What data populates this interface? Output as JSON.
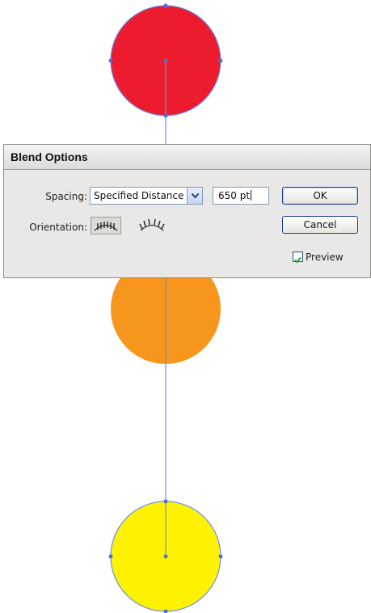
{
  "artwork": {
    "colors": {
      "path": "#6b8ff0",
      "anchor": "#4c6fe0",
      "top_circle": "#ec1c2e",
      "middle_circle": "#f7961c",
      "bottom_circle": "#fff200"
    }
  },
  "dialog": {
    "title": "Blend Options",
    "spacing": {
      "label": "Spacing:",
      "selected": "Specified Distance",
      "value": "650 pt"
    },
    "orientation": {
      "label": "Orientation:",
      "icons": [
        "align-to-page-icon",
        "align-to-path-icon"
      ]
    },
    "buttons": {
      "ok": "OK",
      "cancel": "Cancel"
    },
    "preview": {
      "label": "Preview",
      "checked": true
    }
  }
}
